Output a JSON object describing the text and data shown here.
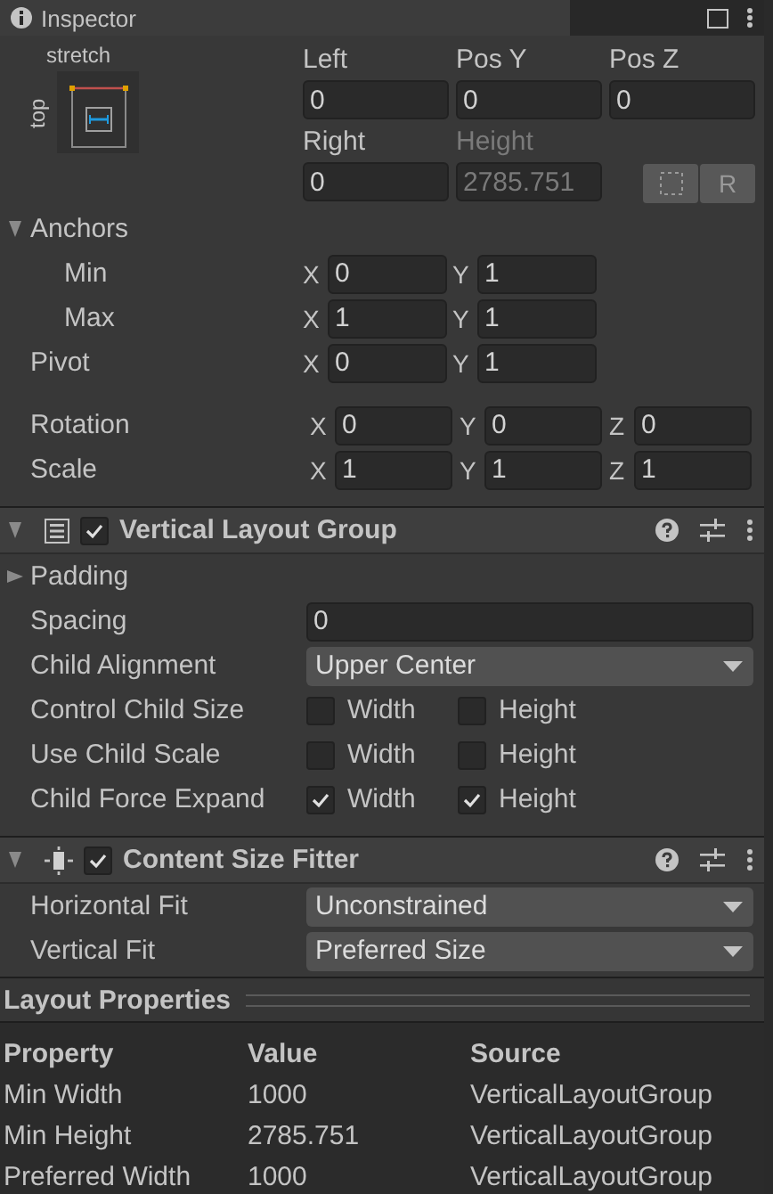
{
  "tab": {
    "title": "Inspector"
  },
  "rect_transform": {
    "anchor_preset": {
      "horizontal": "stretch",
      "vertical": "top"
    },
    "fields": [
      {
        "label": "Left",
        "value": "0",
        "disabled": false
      },
      {
        "label": "Pos Y",
        "value": "0",
        "disabled": false
      },
      {
        "label": "Pos Z",
        "value": "0",
        "disabled": false
      },
      {
        "label": "Right",
        "value": "0",
        "disabled": false
      },
      {
        "label": "Height",
        "value": "2785.751",
        "disabled": true
      }
    ],
    "mode_buttons": [
      {
        "kind": "blueprint",
        "selected": false
      },
      {
        "kind": "raw",
        "label": "R",
        "selected": false
      }
    ],
    "anchors": {
      "label": "Anchors",
      "expanded": true,
      "rows": [
        {
          "label": "Min",
          "axes": [
            {
              "axis": "X",
              "value": "0"
            },
            {
              "axis": "Y",
              "value": "1"
            }
          ]
        },
        {
          "label": "Max",
          "axes": [
            {
              "axis": "X",
              "value": "1"
            },
            {
              "axis": "Y",
              "value": "1"
            }
          ]
        }
      ]
    },
    "pivot": {
      "label": "Pivot",
      "axes": [
        {
          "axis": "X",
          "value": "0"
        },
        {
          "axis": "Y",
          "value": "1"
        }
      ]
    },
    "transform": [
      {
        "label": "Rotation",
        "axes": [
          {
            "axis": "X",
            "value": "0"
          },
          {
            "axis": "Y",
            "value": "0"
          },
          {
            "axis": "Z",
            "value": "0"
          }
        ]
      },
      {
        "label": "Scale",
        "axes": [
          {
            "axis": "X",
            "value": "1"
          },
          {
            "axis": "Y",
            "value": "1"
          },
          {
            "axis": "Z",
            "value": "1"
          }
        ]
      }
    ]
  },
  "components": [
    {
      "title": "Vertical Layout Group",
      "kind": "layout",
      "enabled": true,
      "expanded": true,
      "properties": [
        {
          "kind": "foldout",
          "label": "Padding",
          "expanded": false
        },
        {
          "kind": "number",
          "label": "Spacing",
          "value": "0"
        },
        {
          "kind": "dropdown",
          "label": "Child Alignment",
          "value": "Upper Center"
        },
        {
          "kind": "toggles",
          "label": "Control Child Size",
          "toggles": [
            {
              "label": "Width",
              "checked": false
            },
            {
              "label": "Height",
              "checked": false
            }
          ]
        },
        {
          "kind": "toggles",
          "label": "Use Child Scale",
          "toggles": [
            {
              "label": "Width",
              "checked": false
            },
            {
              "label": "Height",
              "checked": false
            }
          ]
        },
        {
          "kind": "toggles",
          "label": "Child Force Expand",
          "toggles": [
            {
              "label": "Width",
              "checked": true
            },
            {
              "label": "Height",
              "checked": true
            }
          ]
        }
      ]
    },
    {
      "title": "Content Size Fitter",
      "kind": "fitter",
      "enabled": true,
      "expanded": true,
      "properties": [
        {
          "kind": "dropdown",
          "label": "Horizontal Fit",
          "value": "Unconstrained"
        },
        {
          "kind": "dropdown",
          "label": "Vertical Fit",
          "value": "Preferred Size"
        }
      ]
    }
  ],
  "layout_properties": {
    "title": "Layout Properties",
    "columns": [
      "Property",
      "Value",
      "Source"
    ],
    "rows": [
      [
        "Min Width",
        "1000",
        "VerticalLayoutGroup"
      ],
      [
        "Min Height",
        "2785.751",
        "VerticalLayoutGroup"
      ],
      [
        "Preferred Width",
        "1000",
        "VerticalLayoutGroup"
      ]
    ]
  }
}
